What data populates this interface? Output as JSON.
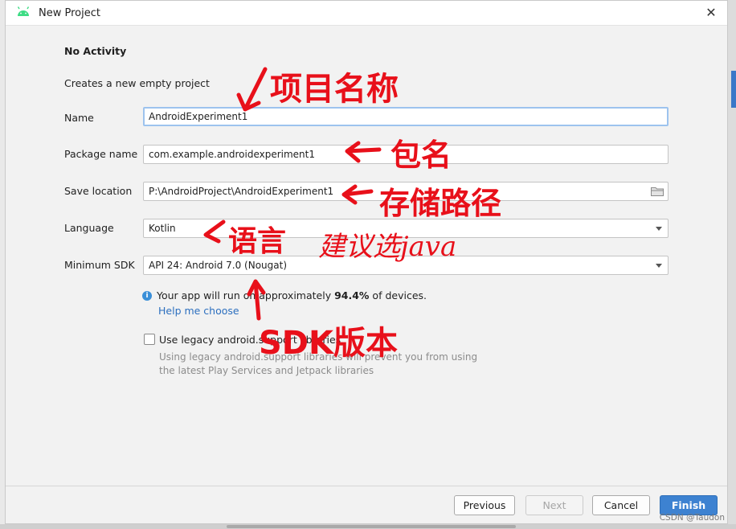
{
  "window": {
    "title": "New Project",
    "close_glyph": "✕"
  },
  "page": {
    "heading": "No Activity",
    "subtitle": "Creates a new empty project"
  },
  "form": {
    "name": {
      "label": "Name",
      "value": "AndroidExperiment1"
    },
    "package": {
      "label": "Package name",
      "value": "com.example.androidexperiment1"
    },
    "save_location": {
      "label": "Save location",
      "value": "P:\\AndroidProject\\AndroidExperiment1"
    },
    "language": {
      "label": "Language",
      "value": "Kotlin"
    },
    "min_sdk": {
      "label": "Minimum SDK",
      "value": "API 24: Android 7.0 (Nougat)"
    }
  },
  "info": {
    "icon": "i",
    "text_before": "Your app will run on approximately ",
    "percent": "94.4%",
    "text_after": " of devices.",
    "help_link": "Help me choose"
  },
  "legacy": {
    "label": "Use legacy android.support libraries",
    "checked": false,
    "desc_line1": "Using legacy android.support libraries will prevent you from using",
    "desc_line2": "the latest Play Services and Jetpack libraries"
  },
  "buttons": {
    "previous": "Previous",
    "next": "Next",
    "cancel": "Cancel",
    "finish": "Finish"
  },
  "watermark": "CSDN @Taudon",
  "annotations": {
    "project_name": "项目名称",
    "package_name": "包名",
    "storage_path": "存储路径",
    "language": "语言",
    "suggest_java": "建议选java",
    "sdk_version": "SDK版本"
  },
  "colors": {
    "annotation_red": "#e8101a",
    "link_blue": "#2c6fbf",
    "primary_button": "#3d82d1",
    "android_green": "#3ddc84"
  }
}
